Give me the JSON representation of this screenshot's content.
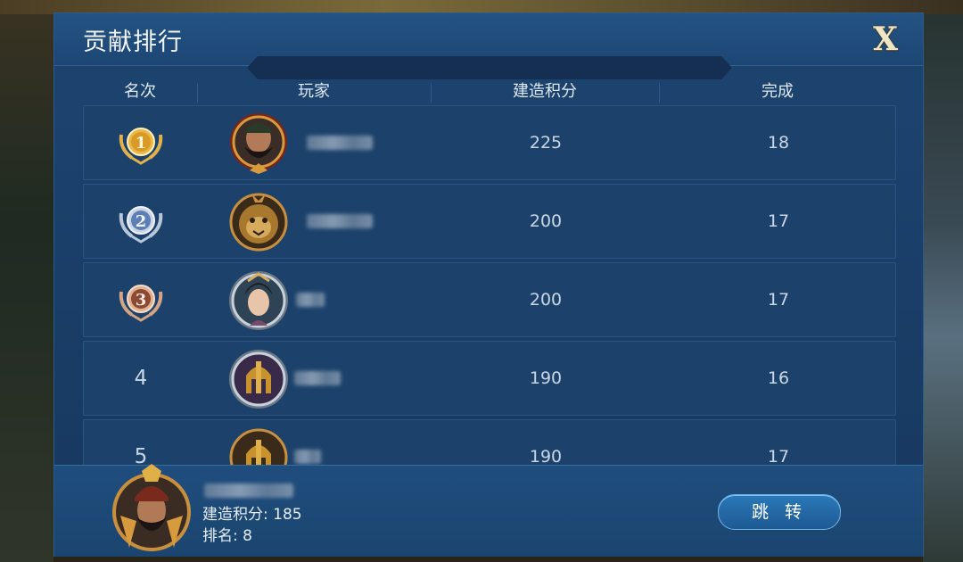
{
  "dialog": {
    "title": "贡献排行",
    "close_label": "X"
  },
  "columns": {
    "rank": "名次",
    "player": "玩家",
    "score": "建造积分",
    "completed": "完成"
  },
  "rows": [
    {
      "rank": "1",
      "medal": "gold-medal",
      "score": "225",
      "completed": "18",
      "avatar": "bearded-warrior-avatar"
    },
    {
      "rank": "2",
      "medal": "silver-medal",
      "score": "200",
      "completed": "17",
      "avatar": "tiger-avatar"
    },
    {
      "rank": "3",
      "medal": "bronze-medal",
      "score": "200",
      "completed": "17",
      "avatar": "lady-avatar"
    },
    {
      "rank": "4",
      "medal": "",
      "score": "190",
      "completed": "16",
      "avatar": "helmet-avatar"
    },
    {
      "rank": "5",
      "medal": "",
      "score": "190",
      "completed": "17",
      "avatar": "helmet-avatar"
    }
  ],
  "me": {
    "score_text": "建造积分: 185",
    "rank_text": "排名: 8",
    "avatar": "general-avatar"
  },
  "actions": {
    "jump_label": "跳 转"
  },
  "colors": {
    "panel": "#1a3e68",
    "gold": "#e2b24a",
    "silver": "#9fb2cc",
    "bronze": "#c98a64"
  }
}
